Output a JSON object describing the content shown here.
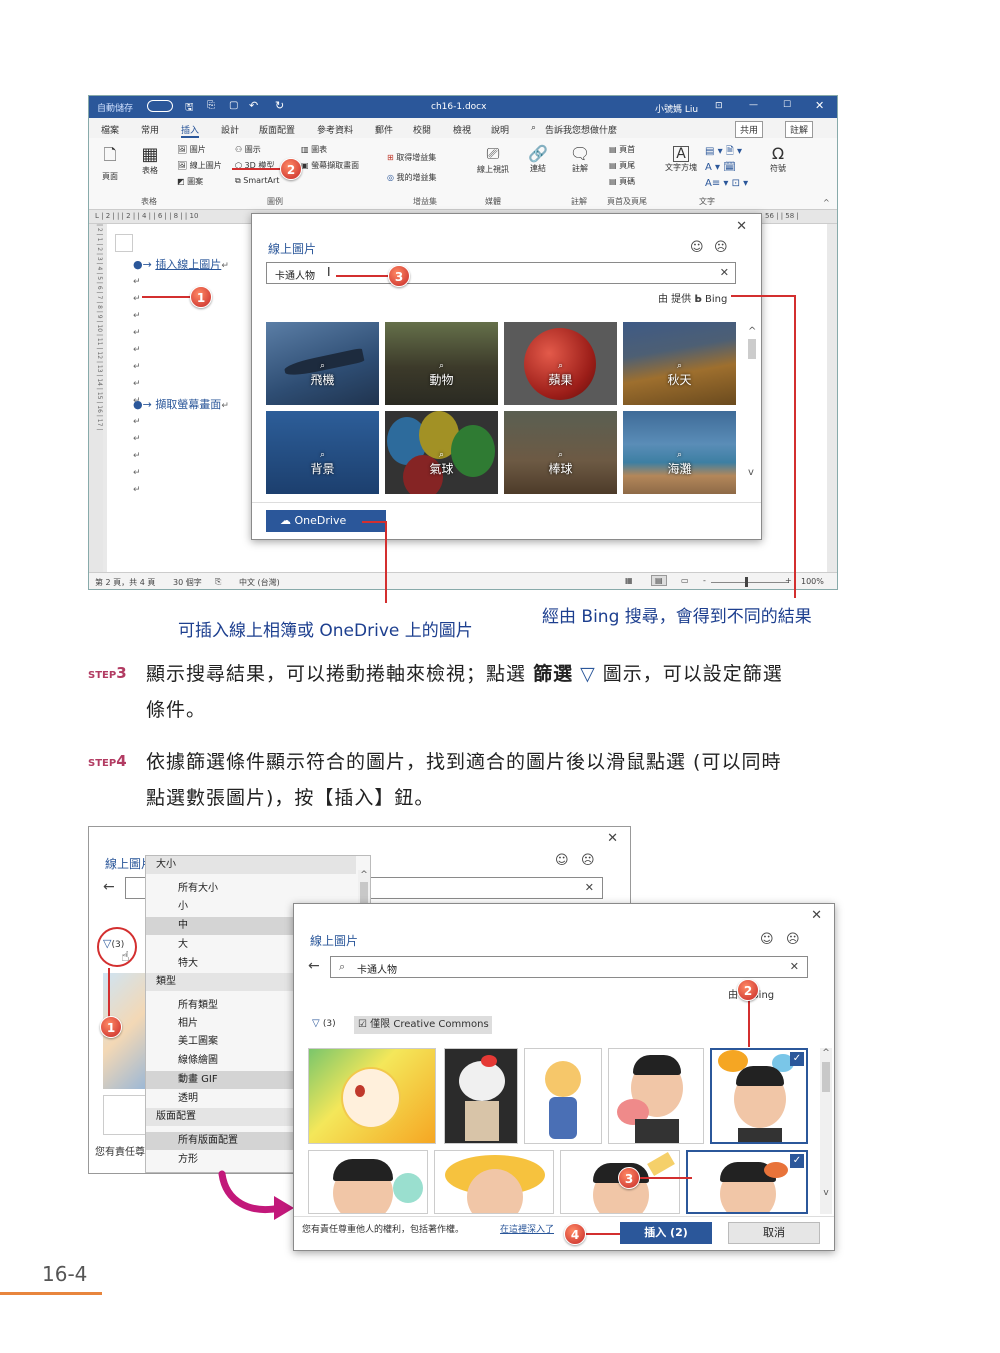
{
  "word": {
    "title": "ch16-1.docx",
    "user": "小號媽 Liu",
    "quick_access": "自動儲存",
    "tabs": [
      "檔案",
      "常用",
      "插入",
      "設計",
      "版面配置",
      "參考資料",
      "郵件",
      "校閱",
      "檢視",
      "說明"
    ],
    "tellme": "告訴我您想做什麼",
    "share": "共用",
    "comment": "註解",
    "ribbon": {
      "page": "頁面",
      "table": "表格",
      "picture": "圖片",
      "online_picture": "線上圖片",
      "shapes": "圖案",
      "icons": "圖示",
      "models3d": "3D 模型",
      "smartart": "SmartArt",
      "chart": "圖表",
      "screenshot": "螢幕擷取畫面",
      "get_addins": "取得增益集",
      "my_addins": "我的增益集",
      "online_video": "線上視訊",
      "link": "連結",
      "comment_btn": "註解",
      "header": "頁首",
      "footer": "頁尾",
      "page_number": "頁碼",
      "textbox": "文字方塊",
      "symbol": "符號",
      "groups": [
        "表格",
        "圖例",
        "增益集",
        "媒體",
        "註解",
        "頁首及頁尾",
        "文字"
      ]
    },
    "doc_lines": [
      "插入線上圖片",
      "擷取螢幕畫面"
    ],
    "status": {
      "page": "第 2 頁，共 4 頁",
      "words": "30 個字",
      "lang": "中文 (台灣)",
      "zoom": "100%"
    }
  },
  "dialog1": {
    "title": "線上圖片",
    "search_value": "卡通人物",
    "powered_by": "由 提供",
    "bing": "Bing",
    "categories": [
      "飛機",
      "動物",
      "蘋果",
      "秋天",
      "背景",
      "氣球",
      "棒球",
      "海灘"
    ],
    "onedrive": "OneDrive"
  },
  "callouts": {
    "left": "可插入線上相簿或 OneDrive 上的圖片",
    "right": "經由 Bing 搜尋，會得到不同的結果"
  },
  "steps": [
    {
      "label": "STEP",
      "num": "3",
      "text1": "顯示搜尋結果，可以捲動捲軸來檢視；點選",
      "bold": "篩選",
      "text2": "圖示，可以設定篩選",
      "text3": "條件。"
    },
    {
      "label": "STEP",
      "num": "4",
      "text1": "依據篩選條件顯示符合的圖片，找到適合的圖片後以滑鼠點選 (可以同時",
      "text2": "點選數張圖片)，按【插入】鈕。"
    }
  ],
  "dialog2": {
    "title": "線上圖片",
    "filter_count": "(3)",
    "footer_text": "您有責任尊重他人的權利",
    "menu": {
      "size_hdr": "大小",
      "sizes": [
        "所有大小",
        "小",
        "中",
        "大",
        "特大"
      ],
      "type_hdr": "類型",
      "types": [
        "所有類型",
        "相片",
        "美工圖案",
        "線條繪圖",
        "動畫 GIF",
        "透明"
      ],
      "layout_hdr": "版面配置",
      "layouts": [
        "所有版面配置",
        "方形"
      ]
    }
  },
  "dialog3": {
    "title": "線上圖片",
    "search_value": "卡通人物",
    "by": "由",
    "bing": "Bing",
    "filter_count": "(3)",
    "cc_label": "僅限 Creative Commons",
    "footer_text": "您有責任尊重他人的權利，包括著作權。",
    "footer_link": "在這裡深入了",
    "insert": "插入 (2)",
    "cancel": "取消"
  },
  "badges": [
    "1",
    "2",
    "3",
    "4"
  ],
  "page_number": "16-4",
  "colors": {
    "word_blue": "#2b579a",
    "callout_red": "#d32f2f",
    "caption_blue": "#1d3f8f",
    "step_pink": "#b23b62",
    "page_orange": "#e8853d"
  }
}
